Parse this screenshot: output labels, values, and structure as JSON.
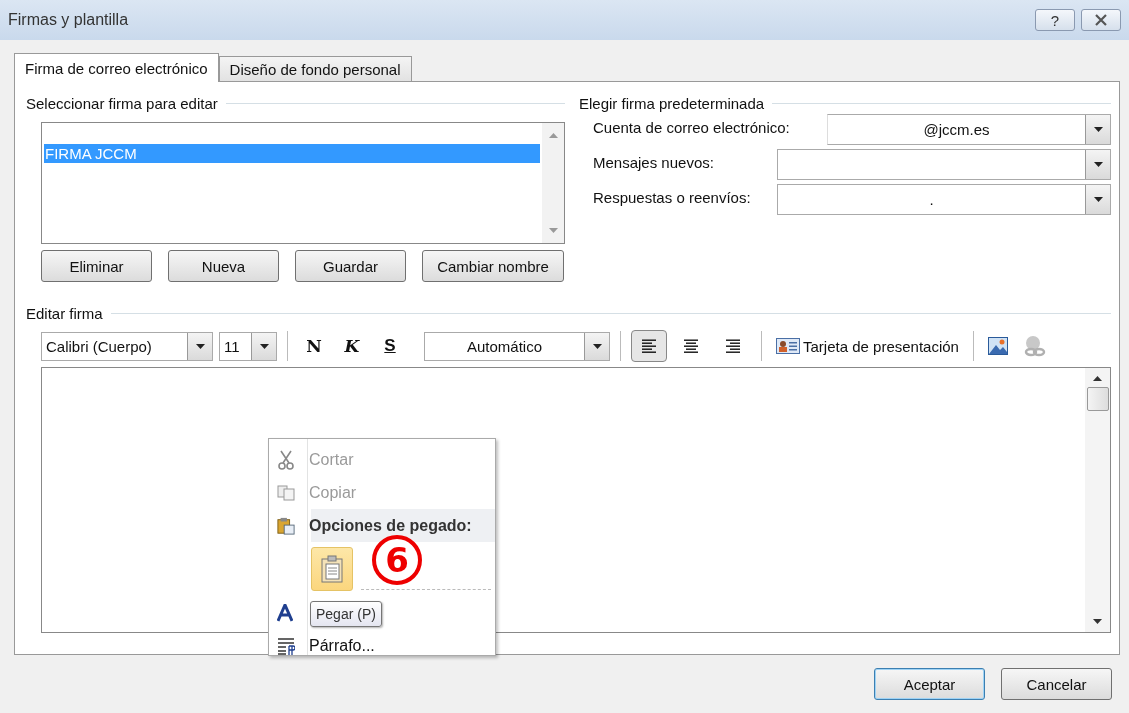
{
  "window": {
    "title": "Firmas y plantilla",
    "help_button": "?"
  },
  "tabs": [
    {
      "label": "Firma de correo electrónico",
      "selected": true
    },
    {
      "label": "Diseño de fondo personal",
      "selected": false
    }
  ],
  "select_signature": {
    "heading": "Seleccionar firma para editar",
    "items": [
      {
        "label": "FIRMA JCCM",
        "selected": true
      }
    ],
    "buttons": [
      "Eliminar",
      "Nueva",
      "Guardar",
      "Cambiar nombre"
    ]
  },
  "default_signature": {
    "heading": "Elegir firma predeterminada",
    "fields": [
      {
        "label": "Cuenta de correo electrónico:",
        "value": "@jccm.es",
        "kind": "account"
      },
      {
        "label": "Mensajes nuevos:",
        "kind": "normal"
      },
      {
        "label": "Respuestas o reenvíos:",
        "value": ".",
        "kind": "normal"
      }
    ]
  },
  "edit_signature": {
    "heading": "Editar firma",
    "font": "Calibri (Cuerpo)",
    "size": "11",
    "bold": "N",
    "italic": "K",
    "underline": "S",
    "color_label": "Automático",
    "align": [
      {
        "kind": "left",
        "selected": true
      },
      {
        "kind": "center",
        "selected": false
      },
      {
        "kind": "right",
        "selected": false
      }
    ],
    "business_card": "Tarjeta de presentación"
  },
  "context_menu": {
    "items": [
      {
        "kind": "cut",
        "label": "Cortar",
        "disabled": true
      },
      {
        "kind": "copy",
        "label": "Copiar",
        "disabled": true
      },
      {
        "kind": "paste-header",
        "label": "Opciones de pegado:"
      },
      {
        "kind": "paste-options"
      },
      {
        "kind": "font"
      },
      {
        "kind": "paragraph",
        "label": "Párrafo...",
        "disabled": false
      }
    ]
  },
  "tooltip": "Pegar (P)",
  "annotation": "6",
  "buttons": [
    {
      "label": "Aceptar",
      "default": true
    },
    {
      "label": "Cancelar",
      "default": false
    }
  ]
}
